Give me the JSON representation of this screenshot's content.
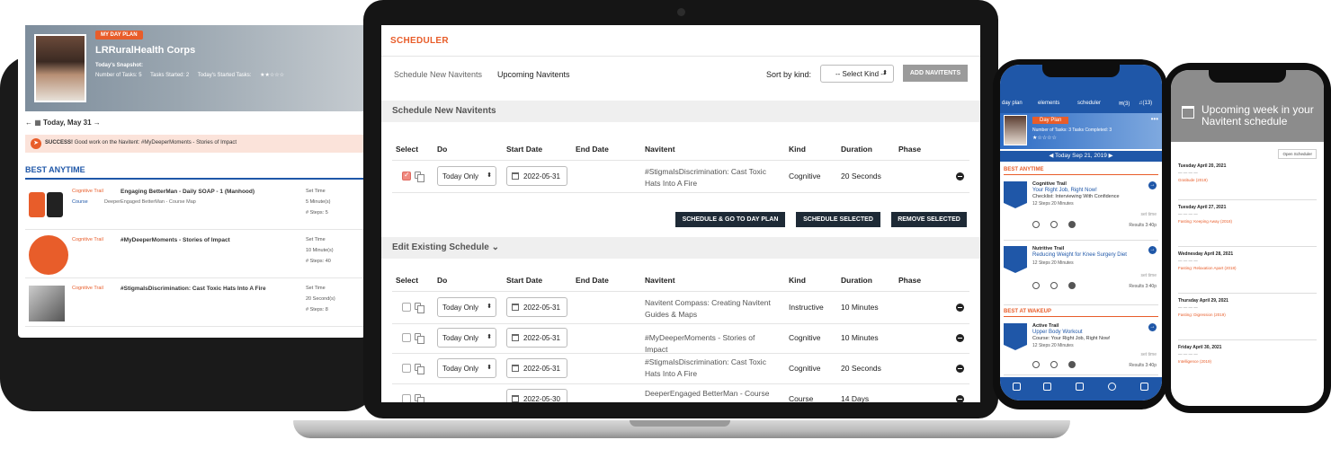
{
  "tablet": {
    "badge": "MY DAY PLAN",
    "org": "LRRuralHealth Corps",
    "snapshot": "Today's Snapshot:",
    "tasks": "Number of Tasks: 5",
    "started": "Tasks Started: 2",
    "today_started": "Today's Started Tasks:",
    "date": "Today, May 31",
    "success_bold": "SUCCESS!",
    "success_text": "Good work on the Navitent: #MyDeeperMoments - Stories of Impact",
    "section": "BEST ANYTIME",
    "items": [
      {
        "kind": "Cognitive Trail",
        "title": "Engaging BetterMan - Daily SOAP - 1 (Manhood)",
        "sub": "Course",
        "sub2": "DeeperEngaged BetterMan - Course Map",
        "m1": "Set Time",
        "m2": "5 Minute(s)",
        "m3": "# Steps: 5"
      },
      {
        "kind": "Cognitive Trail",
        "title": "#MyDeeperMoments - Stories of Impact",
        "sub": "",
        "sub2": "",
        "m1": "Set Time",
        "m2": "10 Minute(s)",
        "m3": "# Steps: 40"
      },
      {
        "kind": "Cognitive Trail",
        "title": "#StigmaIsDiscrimination: Cast Toxic Hats Into A Fire",
        "sub": "",
        "sub2": "",
        "m1": "Set Time",
        "m2": "20 Second(s)",
        "m3": "# Steps: 8"
      }
    ]
  },
  "scheduler": {
    "title": "SCHEDULER",
    "tab_new": "Schedule New Navitents",
    "tab_upcoming": "Upcoming Navitents",
    "sort_label": "Sort by kind:",
    "sort_value": "-- Select Kind --",
    "add_button": "ADD NAVITENTS",
    "section_new": "Schedule New Navitents",
    "section_edit": "Edit Existing Schedule",
    "columns": [
      "Select",
      "Do",
      "Start Date",
      "End Date",
      "Navitent",
      "Kind",
      "Duration",
      "Phase"
    ],
    "new_rows": [
      {
        "do": "Today Only",
        "start": "2022-05-31",
        "navitent": "#StigmaIsDiscrimination: Cast Toxic Hats Into A Fire",
        "kind": "Cognitive",
        "duration": "20 Seconds",
        "checked": true
      }
    ],
    "buttons": {
      "go": "SCHEDULE & GO TO DAY PLAN",
      "schedule": "SCHEDULE SELECTED",
      "remove": "REMOVE SELECTED"
    },
    "edit_rows": [
      {
        "do": "Today Only",
        "start": "2022-05-31",
        "navitent": "Navitent Compass: Creating Navitent Guides & Maps",
        "kind": "Instructive",
        "duration": "10 Minutes"
      },
      {
        "do": "Today Only",
        "start": "2022-05-31",
        "navitent": "#MyDeeperMoments - Stories of Impact",
        "kind": "Cognitive",
        "duration": "10 Minutes"
      },
      {
        "do": "Today Only",
        "start": "2022-05-31",
        "navitent": "#StigmaIsDiscrimination: Cast Toxic Hats Into A Fire",
        "kind": "Cognitive",
        "duration": "20 Seconds"
      },
      {
        "do": "",
        "start": "2022-05-30",
        "navitent": "DeeperEngaged BetterMan - Course",
        "kind": "Course",
        "duration": "14 Days"
      }
    ]
  },
  "phone1": {
    "nav": [
      "day plan",
      "elements",
      "scheduler"
    ],
    "counts": [
      "(3)",
      "(13)"
    ],
    "day_plan": "Day Plan",
    "tasks_line": "Number of Tasks: 3    Tasks Completed: 3",
    "date": "Today Sep 21, 2019",
    "section1": "BEST ANYTIME",
    "section2": "BEST AT WAKEUP",
    "cards": [
      {
        "kind": "Cognitive Trail",
        "name": "Your Right Job, Right Now!",
        "desc": "Checklist: Interviewing With Confidence",
        "steps": "12 Steps  20 Minutes",
        "settime": "set time",
        "results": "Results 3:40p"
      },
      {
        "kind": "Nutritive Trail",
        "name": "Reducing Weight for Knee Surgery Diet",
        "desc": "",
        "steps": "12 Steps  20 Minutes",
        "settime": "set time",
        "results": "Results 3:40p"
      },
      {
        "kind": "Active Trail",
        "name": "Upper Body Workout",
        "desc": "Course: Your Right Job, Right Now!",
        "steps": "12 Steps  20 Minutes",
        "settime": "set time",
        "results": "Results 3:40p"
      }
    ]
  },
  "phone2": {
    "title": "Upcoming week in your Navitent schedule",
    "open": "Open Scheduler",
    "days": [
      "Tuesday April 20, 2021",
      "Tuesday April 27, 2021",
      "Wednesday April 28, 2021",
      "Thursday April 29, 2021",
      "Friday April 30, 2021"
    ],
    "highlights": [
      "Gratitude (2019)",
      "Fasting: Keeping Away (2018)",
      "Fasting: Relaxation Apart (2018)",
      "Fasting: Digression (2019)",
      "Intelligence (2019)"
    ]
  },
  "colors": {
    "accent": "#e85d2a",
    "brand_blue": "#1f57a8",
    "dark_button": "#1e2a36"
  }
}
